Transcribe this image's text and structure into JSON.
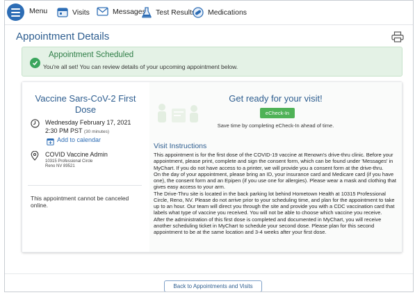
{
  "nav": {
    "menu_label": "Menu",
    "visits_label": "Visits",
    "messages_label": "Messages",
    "test_results_label": "Test Results",
    "medications_label": "Medications"
  },
  "page": {
    "title": "Appointment Details"
  },
  "banner": {
    "title": "Appointment Scheduled",
    "message": "You're all set! You can review details of your upcoming appointment below."
  },
  "appointment": {
    "title": "Vaccine Sars-CoV-2 First Dose",
    "date": "Wednesday February 17, 2021",
    "time": "2:30 PM PST",
    "duration": "(30 minutes)",
    "add_calendar": "Add to calendar",
    "location_name": "COVID Vaccine Admin",
    "address_line1": "10315 Professional Circle",
    "address_line2": "Reno NV 89521",
    "cancel_note": "This appointment cannot be canceled online."
  },
  "checkin": {
    "heading": "Get ready for your visit!",
    "button_label": "eCheck-In",
    "subtext": "Save time by completing eCheck-In ahead of time."
  },
  "visit_instructions": {
    "heading": "Visit Instructions",
    "paragraphs": [
      "This appointment is for the first dose of the COVID-19 vaccine at Renown's drive-thru clinic. Before your appointment, please print, complete and sign the consent form, which can be found under 'Messages' in MyChart. If you do not have access to a printer, we will provide you a consent form at the drive-thru.",
      "On the day of your appointment, please bring an ID, your insurance card and Medicare card (if you have one), the consent form and an Epipen (if you use one for allergies). Please wear a mask and clothing that gives easy access to your arm.",
      "The Drive-Thru site is located in the back parking lot behind Hometown Health at 10315 Professional Circle, Reno, NV. Please do not arrive prior to your scheduling time, and plan for the appointment to take up to an hour.  Our team will direct you through the site and provide you with a CDC vaccination card that labels what type of vaccine you received. You will not be able to choose which vaccine you receive.",
      "After the administration of this first dose is completed and documented in MyChart, you will receive another scheduling ticket in MyChart to schedule your second dose. Please plan for this second appointment to be at the same location and 3-4 weeks after your first dose."
    ]
  },
  "footer": {
    "back_button": "Back to Appointments and Visits"
  },
  "colors": {
    "accent": "#2d5d8f",
    "menu_button": "#2d6db5",
    "success_bg": "#e4f2e6",
    "success_text": "#2e7d46",
    "checkin_button": "#4fb257"
  },
  "icons": {
    "menu": "hamburger-icon",
    "visits": "calendar-icon",
    "messages": "envelope-icon",
    "test_results": "flask-icon",
    "medications": "pill-icon",
    "print": "printer-icon",
    "success": "check-circle-icon",
    "time": "clock-icon",
    "calendar": "calendar-add-icon",
    "location": "map-pin-icon"
  }
}
